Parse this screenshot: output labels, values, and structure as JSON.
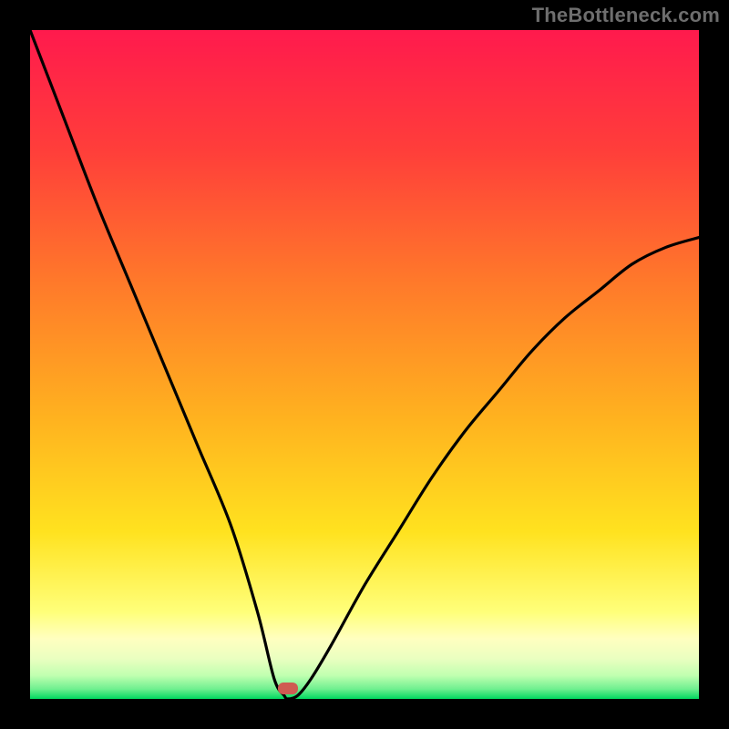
{
  "watermark": "TheBottleneck.com",
  "marker": {
    "x_frac": 0.385,
    "y_frac": 0.985,
    "w": 22,
    "h": 13
  },
  "colors": {
    "top": "#ff1a4d",
    "mid_upper": "#ff6a2a",
    "mid": "#ffd21f",
    "band_light": "#ffffb0",
    "band_pale_green": "#d6ffb0",
    "bottom": "#00e060",
    "curve": "#000000",
    "marker": "#cf5b52"
  },
  "chart_data": {
    "type": "line",
    "title": "",
    "xlabel": "",
    "ylabel": "",
    "xlim": [
      0,
      1
    ],
    "ylim": [
      0,
      1
    ],
    "series": [
      {
        "name": "bottleneck-curve",
        "x": [
          0.0,
          0.05,
          0.1,
          0.15,
          0.2,
          0.25,
          0.3,
          0.34,
          0.365,
          0.38,
          0.385,
          0.4,
          0.42,
          0.45,
          0.5,
          0.55,
          0.6,
          0.65,
          0.7,
          0.75,
          0.8,
          0.85,
          0.9,
          0.95,
          1.0
        ],
        "y": [
          1.0,
          0.87,
          0.74,
          0.62,
          0.5,
          0.38,
          0.26,
          0.13,
          0.03,
          0.005,
          0.0,
          0.005,
          0.03,
          0.08,
          0.17,
          0.25,
          0.33,
          0.4,
          0.46,
          0.52,
          0.57,
          0.61,
          0.65,
          0.675,
          0.69
        ]
      }
    ],
    "annotations": [
      {
        "text": "TheBottleneck.com",
        "position": "top-right"
      }
    ]
  }
}
